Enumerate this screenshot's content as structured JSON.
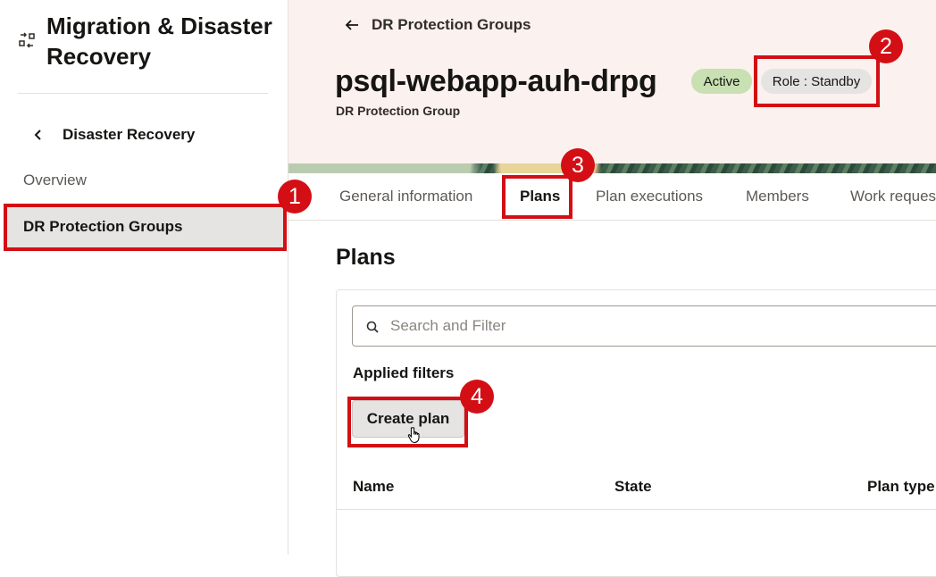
{
  "sidebar": {
    "app_title": "Migration & Disaster Recovery",
    "back_label": "Disaster Recovery",
    "items": [
      {
        "label": "Overview",
        "active": false
      },
      {
        "label": "DR Protection Groups",
        "active": true
      }
    ]
  },
  "header": {
    "breadcrumb": "DR Protection Groups",
    "title": "psql-webapp-auh-drpg",
    "subtitle": "DR Protection Group",
    "status_badge": "Active",
    "role_badge": "Role : Standby"
  },
  "tabs": [
    {
      "label": "General information",
      "active": false
    },
    {
      "label": "Plans",
      "active": true
    },
    {
      "label": "Plan executions",
      "active": false
    },
    {
      "label": "Members",
      "active": false
    },
    {
      "label": "Work reques",
      "active": false
    }
  ],
  "main": {
    "section_title": "Plans",
    "search": {
      "placeholder": "Search and Filter",
      "value": ""
    },
    "applied_filters_label": "Applied filters",
    "create_button": "Create plan",
    "table": {
      "columns": [
        "Name",
        "State",
        "Plan type"
      ],
      "rows": []
    }
  },
  "annotations": [
    {
      "number": "1"
    },
    {
      "number": "2"
    },
    {
      "number": "3"
    },
    {
      "number": "4"
    }
  ],
  "colors": {
    "annotation_red": "#d30f15",
    "header_bg": "#fbf1ee",
    "active_badge_bg": "#c8e0b2",
    "role_badge_bg": "#e5e4e2"
  }
}
